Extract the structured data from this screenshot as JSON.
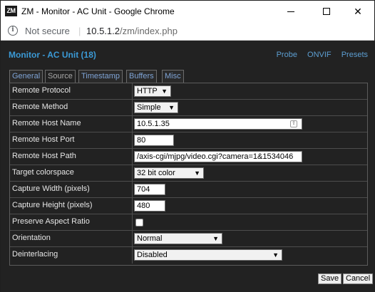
{
  "window": {
    "app_icon_text": "ZM",
    "title": "ZM - Monitor - AC Unit - Google Chrome"
  },
  "address_bar": {
    "security_label": "Not secure",
    "separator": "|",
    "url_host": "10.5.1.2",
    "url_path": "/zm/index.php"
  },
  "page": {
    "title": "Monitor - AC Unit (18)",
    "links": [
      "Probe",
      "ONVIF",
      "Presets"
    ]
  },
  "tabs": [
    "General",
    "Source",
    "Timestamp",
    "Buffers",
    "Misc"
  ],
  "active_tab": "Source",
  "form": {
    "remote_protocol": {
      "label": "Remote Protocol",
      "value": "HTTP"
    },
    "remote_method": {
      "label": "Remote Method",
      "value": "Simple"
    },
    "remote_host_name": {
      "label": "Remote Host Name",
      "value": "10.5.1.35"
    },
    "remote_host_port": {
      "label": "Remote Host Port",
      "value": "80"
    },
    "remote_host_path": {
      "label": "Remote Host Path",
      "value": "/axis-cgi/mjpg/video.cgi?camera=1&1534046"
    },
    "target_colorspace": {
      "label": "Target colorspace",
      "value": "32 bit color"
    },
    "capture_width": {
      "label": "Capture Width (pixels)",
      "value": "704"
    },
    "capture_height": {
      "label": "Capture Height (pixels)",
      "value": "480"
    },
    "preserve_aspect_ratio": {
      "label": "Preserve Aspect Ratio",
      "checked": false
    },
    "orientation": {
      "label": "Orientation",
      "value": "Normal"
    },
    "deinterlacing": {
      "label": "Deinterlacing",
      "value": "Disabled"
    }
  },
  "buttons": {
    "save": "Save",
    "cancel": "Cancel"
  }
}
